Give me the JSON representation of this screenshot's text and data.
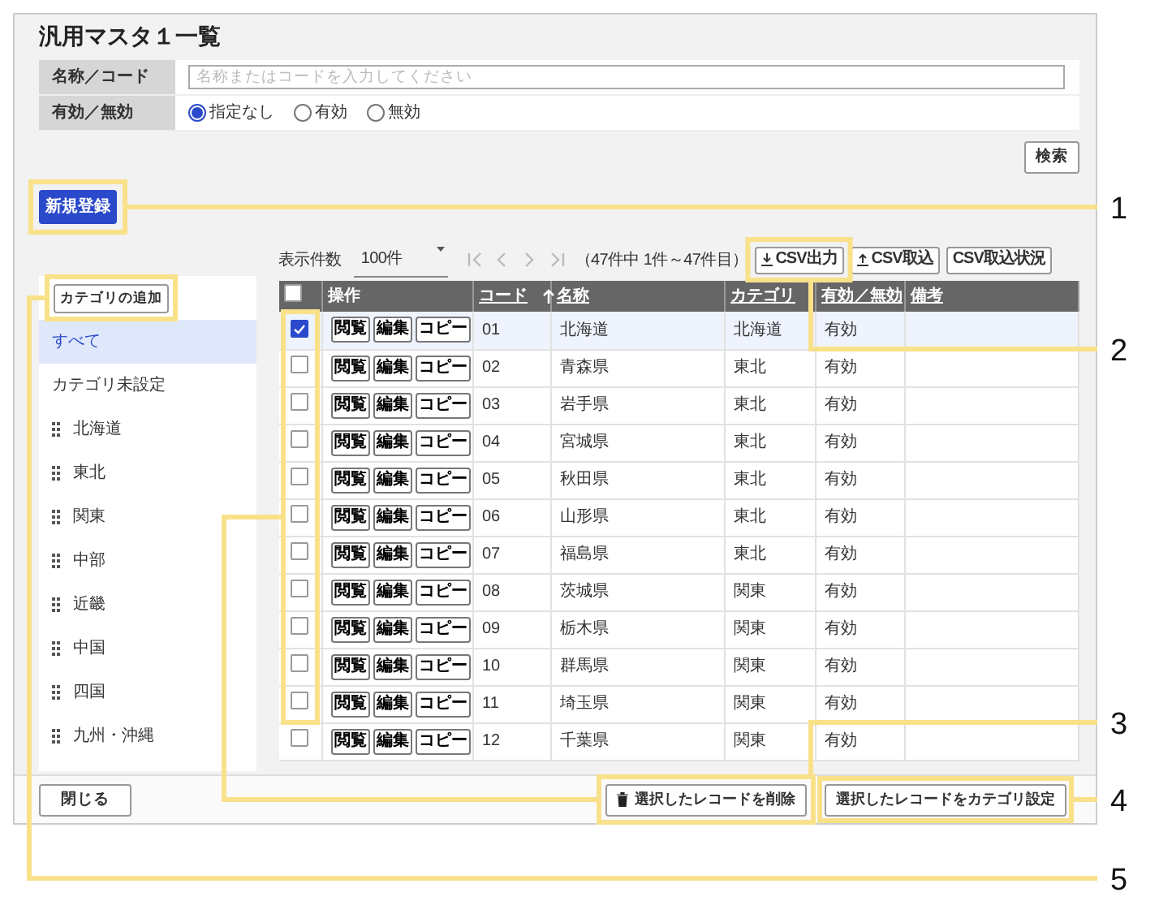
{
  "title": "汎用マスタ１一覧",
  "filters": [
    {
      "label": "名称／コード",
      "kind": "text",
      "placeholder": "名称またはコードを入力してください"
    },
    {
      "label": "有効／無効",
      "kind": "radio",
      "options": [
        {
          "label": "指定なし",
          "selected": true
        },
        {
          "label": "有効",
          "selected": false
        },
        {
          "label": "無効",
          "selected": false
        }
      ]
    }
  ],
  "search_button": "検索",
  "new_button": "新規登録",
  "toolbar": {
    "page_size_label": "表示件数",
    "page_size": "100件",
    "range": "（47件中 1件～47件目）",
    "buttons": [
      {
        "label": "CSV出力",
        "kind": "download"
      },
      {
        "label": "CSV取込",
        "kind": "upload"
      },
      {
        "label": "CSV取込状況",
        "kind": "plain"
      }
    ]
  },
  "sidebar": {
    "add_button": "カテゴリの追加",
    "items": [
      {
        "label": "すべて",
        "kind": "plain",
        "selected": true
      },
      {
        "label": "カテゴリ未設定",
        "kind": "plain",
        "selected": false
      },
      {
        "label": "北海道",
        "kind": "draggable",
        "selected": false
      },
      {
        "label": "東北",
        "kind": "draggable",
        "selected": false
      },
      {
        "label": "関東",
        "kind": "draggable",
        "selected": false
      },
      {
        "label": "中部",
        "kind": "draggable",
        "selected": false
      },
      {
        "label": "近畿",
        "kind": "draggable",
        "selected": false
      },
      {
        "label": "中国",
        "kind": "draggable",
        "selected": false
      },
      {
        "label": "四国",
        "kind": "draggable",
        "selected": false
      },
      {
        "label": "九州・沖縄",
        "kind": "draggable",
        "selected": false
      }
    ]
  },
  "table": {
    "select_all_checked": false,
    "columns": [
      {
        "label": "操作",
        "sortable": false
      },
      {
        "label": "コード",
        "sortable": true,
        "sorted_ascending": true
      },
      {
        "label": "名称",
        "sortable": true
      },
      {
        "label": "カテゴリ",
        "sortable": true
      },
      {
        "label": "有効／無効",
        "sortable": true
      },
      {
        "label": "備考",
        "sortable": true
      }
    ],
    "rows": [
      {
        "selected": true,
        "actions": [
          "閲覧",
          "編集",
          "コピー"
        ],
        "code": "01",
        "name": "北海道",
        "category": "北海道",
        "status": "有効"
      },
      {
        "selected": false,
        "actions": [
          "閲覧",
          "編集",
          "コピー"
        ],
        "code": "02",
        "name": "青森県",
        "category": "東北",
        "status": "有効"
      },
      {
        "selected": false,
        "actions": [
          "閲覧",
          "編集",
          "コピー"
        ],
        "code": "03",
        "name": "岩手県",
        "category": "東北",
        "status": "有効"
      },
      {
        "selected": false,
        "actions": [
          "閲覧",
          "編集",
          "コピー"
        ],
        "code": "04",
        "name": "宮城県",
        "category": "東北",
        "status": "有効"
      },
      {
        "selected": false,
        "actions": [
          "閲覧",
          "編集",
          "コピー"
        ],
        "code": "05",
        "name": "秋田県",
        "category": "東北",
        "status": "有効"
      },
      {
        "selected": false,
        "actions": [
          "閲覧",
          "編集",
          "コピー"
        ],
        "code": "06",
        "name": "山形県",
        "category": "東北",
        "status": "有効"
      },
      {
        "selected": false,
        "actions": [
          "閲覧",
          "編集",
          "コピー"
        ],
        "code": "07",
        "name": "福島県",
        "category": "東北",
        "status": "有効"
      },
      {
        "selected": false,
        "actions": [
          "閲覧",
          "編集",
          "コピー"
        ],
        "code": "08",
        "name": "茨城県",
        "category": "関東",
        "status": "有効"
      },
      {
        "selected": false,
        "actions": [
          "閲覧",
          "編集",
          "コピー"
        ],
        "code": "09",
        "name": "栃木県",
        "category": "関東",
        "status": "有効"
      },
      {
        "selected": false,
        "actions": [
          "閲覧",
          "編集",
          "コピー"
        ],
        "code": "10",
        "name": "群馬県",
        "category": "関東",
        "status": "有効"
      },
      {
        "selected": false,
        "actions": [
          "閲覧",
          "編集",
          "コピー"
        ],
        "code": "11",
        "name": "埼玉県",
        "category": "関東",
        "status": "有効"
      },
      {
        "selected": false,
        "actions": [
          "閲覧",
          "編集",
          "コピー"
        ],
        "code": "12",
        "name": "千葉県",
        "category": "関東",
        "status": "有効"
      }
    ]
  },
  "footer": {
    "close_button": "閉じる",
    "delete_button": "選択したレコードを削除",
    "category_button": "選択したレコードをカテゴリ設定"
  },
  "annotations": [
    "1",
    "2",
    "3",
    "4",
    "5"
  ]
}
